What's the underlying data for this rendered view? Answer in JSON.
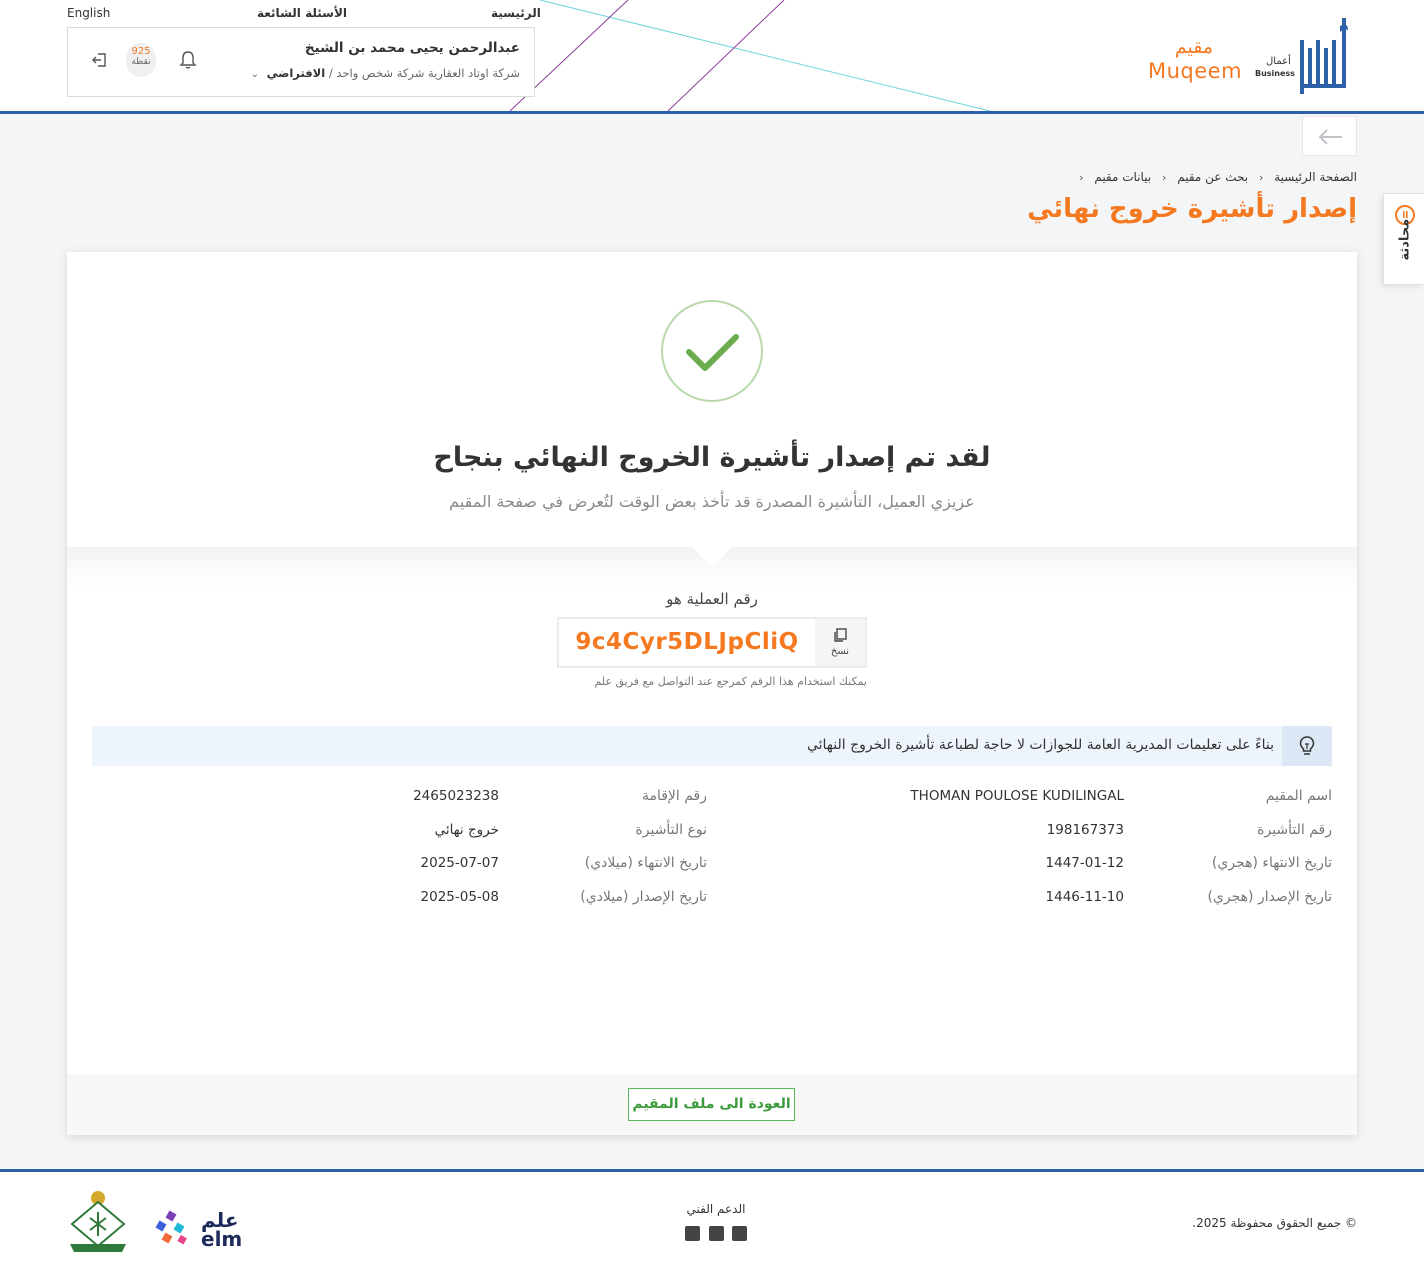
{
  "header": {
    "english_link": "English",
    "faq_link": "الأسئلة الشائعة",
    "home_link": "الرئيسية",
    "user_name": "عبدالرحمن يحيى محمد بن الشيخ",
    "company": "شركة اوتاد العقارية شركة شخص واحد",
    "role": "الافتراضي",
    "points_value": "925",
    "points_label": "نقطة",
    "muqeem_ar": "مقيم",
    "muqeem_en": "Muqeem",
    "absher_ar": "أعمال",
    "absher_en": "Business"
  },
  "breadcrumb": {
    "items": [
      "الصفحة الرئيسية",
      "بحث عن مقيم",
      "بيانات مقيم"
    ]
  },
  "page_title": "إصدار تأشيرة خروج نهائي",
  "chat_tab": "محادثة",
  "success": {
    "title": "لقد تم إصدار تأشيرة الخروج النهائي بنجاح",
    "subtitle": "عزيزي العميل، التأشيرة المصدرة قد تأخذ بعض الوقت لتُعرض في صفحة المقيم"
  },
  "transaction": {
    "label": "رقم العملية هو",
    "code": "9c4Cyr5DLJpCliQ",
    "copy_label": "نسخ",
    "hint": "يمكنك استخدام هذا الرقم كمرجع عند التواصل مع فريق علم"
  },
  "info_notice": "بناءً على تعليمات المديرية العامة للجوازات لا حاجة لطباعة تأشيرة الخروج النهائي",
  "details": {
    "resident_name_label": "اسم المقيم",
    "resident_name": "THOMAN POULOSE KUDILINGAL",
    "iqama_label": "رقم الإقامة",
    "iqama": "2465023238",
    "visa_number_label": "رقم التأشيرة",
    "visa_number": "198167373",
    "visa_type_label": "نوع التأشيرة",
    "visa_type": "خروج نهائي",
    "expiry_hijri_label": "تاريخ الانتهاء (هجري)",
    "expiry_hijri": "1447-01-12",
    "expiry_greg_label": "تاريخ الانتهاء (ميلادي)",
    "expiry_greg": "2025-07-07",
    "issue_hijri_label": "تاريخ الإصدار (هجري)",
    "issue_hijri": "1446-11-10",
    "issue_greg_label": "تاريخ الإصدار (ميلادي)",
    "issue_greg": "2025-05-08"
  },
  "back_to_profile": "العودة الى ملف المقيم",
  "footer": {
    "copyright": "© جميع الحقوق محفوظة 2025.",
    "support_label": "الدعم الفني",
    "elm_ar": "علم",
    "elm_en": "elm"
  },
  "colors": {
    "accent_orange": "#f47920",
    "brand_blue": "#2e61a8",
    "success_green": "#6aad4e"
  }
}
